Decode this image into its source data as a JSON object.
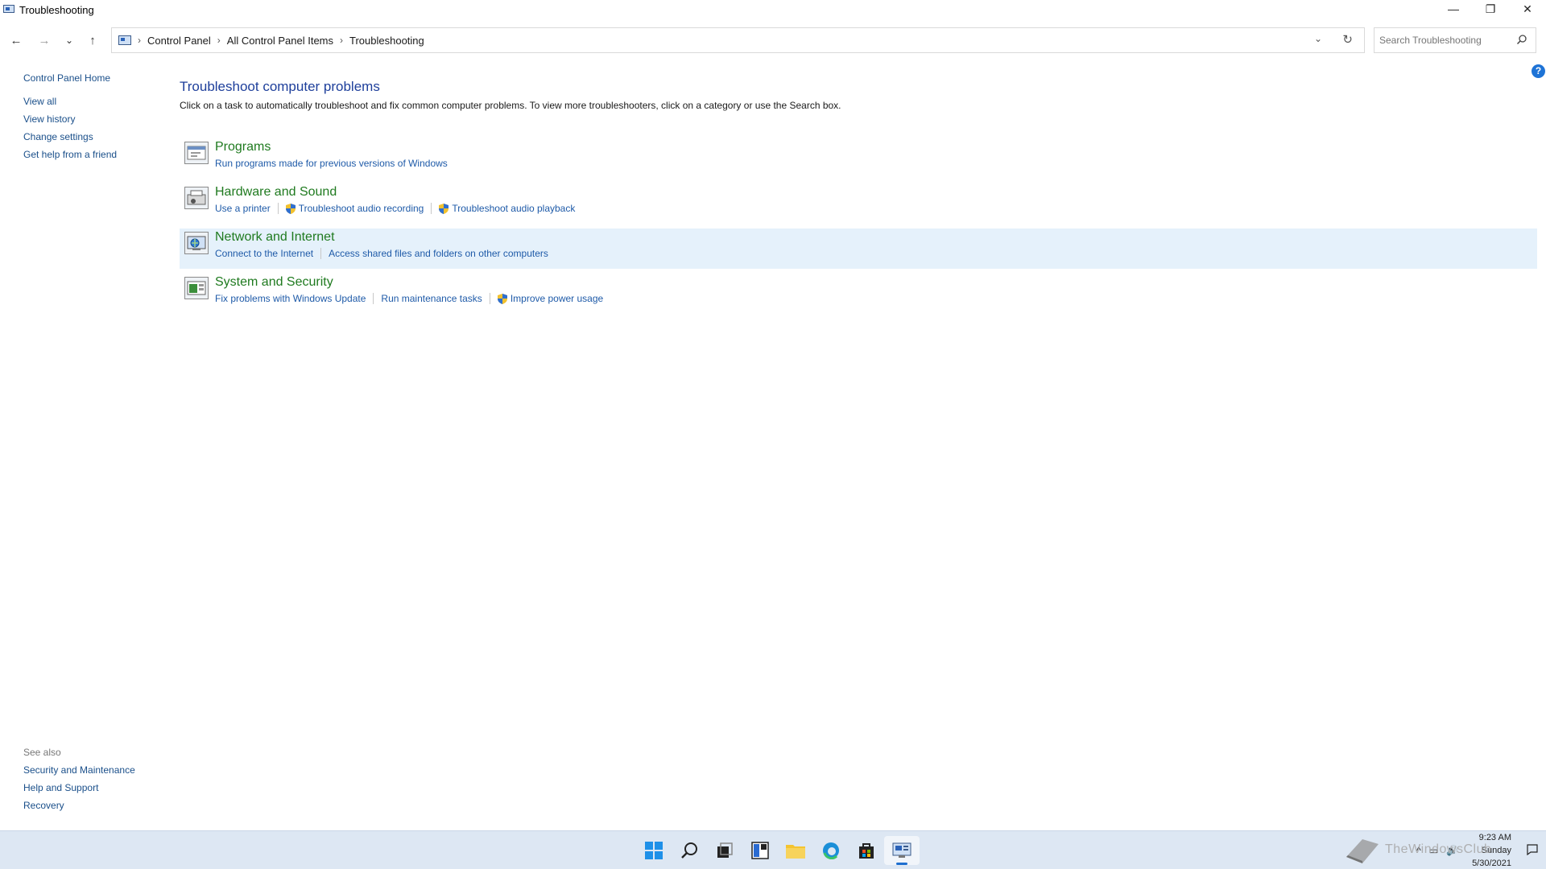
{
  "window": {
    "title": "Troubleshooting",
    "controls": {
      "minimize": "—",
      "restore": "❐",
      "close": "✕"
    }
  },
  "nav": {
    "back": "←",
    "forward": "→",
    "recent": "⌄",
    "up": "↑",
    "breadcrumb": [
      "Control Panel",
      "All Control Panel Items",
      "Troubleshooting"
    ],
    "breadcrumb_sep": "›",
    "dropdown": "⌄",
    "refresh": "↻",
    "search_placeholder": "Search Troubleshooting"
  },
  "help_badge": "?",
  "sidebar": {
    "home": "Control Panel Home",
    "links": [
      "View all",
      "View history",
      "Change settings",
      "Get help from a friend"
    ],
    "see_also_header": "See also",
    "see_also": [
      "Security and Maintenance",
      "Help and Support",
      "Recovery"
    ]
  },
  "main": {
    "title": "Troubleshoot computer problems",
    "description": "Click on a task to automatically troubleshoot and fix common computer problems. To view more troubleshooters, click on a category or use the Search box."
  },
  "categories": [
    {
      "name": "Programs",
      "icon": "programs-icon",
      "links": [
        {
          "label": "Run programs made for previous versions of Windows",
          "shield": false
        }
      ]
    },
    {
      "name": "Hardware and Sound",
      "icon": "hardware-sound-icon",
      "links": [
        {
          "label": "Use a printer",
          "shield": false
        },
        {
          "label": "Troubleshoot audio recording",
          "shield": true
        },
        {
          "label": "Troubleshoot audio playback",
          "shield": true
        }
      ]
    },
    {
      "name": "Network and Internet",
      "icon": "network-internet-icon",
      "highlighted": true,
      "links": [
        {
          "label": "Connect to the Internet",
          "shield": false
        },
        {
          "label": "Access shared files and folders on other computers",
          "shield": false
        }
      ]
    },
    {
      "name": "System and Security",
      "icon": "system-security-icon",
      "links": [
        {
          "label": "Fix problems with Windows Update",
          "shield": false
        },
        {
          "label": "Run maintenance tasks",
          "shield": false
        },
        {
          "label": "Improve power usage",
          "shield": true
        }
      ]
    }
  ],
  "taskbar": {
    "apps": [
      "start-icon",
      "search-icon",
      "task-view-icon",
      "widgets-icon",
      "file-explorer-icon",
      "edge-icon",
      "store-icon",
      "control-panel-icon"
    ],
    "tray": {
      "chevron": "^",
      "network": "▭",
      "volume": "🔊"
    },
    "clock": {
      "time": "9:23 AM",
      "day": "Sunday",
      "date": "5/30/2021"
    },
    "watermark": "TheWindowsClub"
  },
  "colors": {
    "accent": "#1e73d6",
    "link": "#1e5aa8",
    "category": "#1f7a1f",
    "title": "#1e3f9b",
    "highlight": "#e5f1fb",
    "taskbar": "#dde7f3"
  }
}
